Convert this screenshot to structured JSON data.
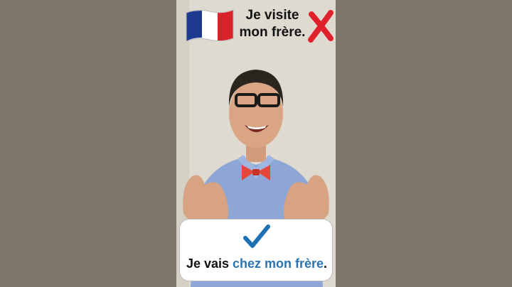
{
  "caption_top": {
    "line1": "Je visite",
    "line2": "mon frère."
  },
  "caption_bottom": {
    "before": "Je vais ",
    "highlight": "chez mon frère",
    "after": "."
  },
  "icons": {
    "flag": "france-flag-icon",
    "incorrect": "red-cross-icon",
    "correct": "blue-check-icon"
  },
  "colors": {
    "highlight": "#2a74b4",
    "cross": "#e0212b",
    "check": "#1f6fb3",
    "flag_blue": "#1d3a8f",
    "flag_red": "#d8232a"
  }
}
